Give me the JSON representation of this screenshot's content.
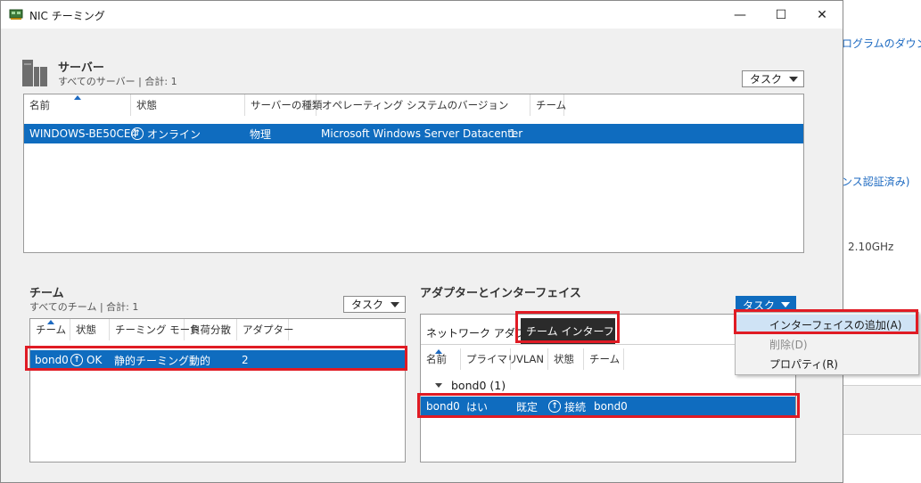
{
  "window": {
    "title": "NIC チーミング",
    "minimize_glyph": "—",
    "maximize_glyph": "☐",
    "close_glyph": "✕"
  },
  "background_app": {
    "line1": "ログラムのダウンロード",
    "line2": "ンス認証済み)",
    "line3": "2.10GHz"
  },
  "servers": {
    "title": "サーバー",
    "subtitle": "すべてのサーバー | 合計: 1",
    "task_label": "タスク",
    "columns": [
      "名前",
      "状態",
      "サーバーの種類",
      "オペレーティング システムのバージョン",
      "チーム"
    ],
    "row": {
      "name": "WINDOWS-BE50CE4",
      "status": "オンライン",
      "server_type": "物理",
      "os_version": "Microsoft Windows Server Datacenter",
      "teams": "1"
    }
  },
  "teams": {
    "title": "チーム",
    "subtitle": "すべてのチーム | 合計: 1",
    "task_label": "タスク",
    "columns": [
      "チーム",
      "状態",
      "チーミング モード",
      "負荷分散",
      "アダプター"
    ],
    "row": {
      "team": "bond0",
      "status": "OK",
      "mode": "静的チーミング",
      "load_balancing": "動的",
      "adapters": "2"
    }
  },
  "adapters": {
    "title": "アダプターとインターフェイス",
    "task_label": "タスク",
    "tabs": [
      "ネットワーク アダプター",
      "チーム インターフェイス"
    ],
    "columns": [
      "名前",
      "プライマリ",
      "VLAN",
      "状態",
      "チーム"
    ],
    "group_label": "bond0 (1)",
    "row": {
      "name": "bond0",
      "primary": "はい",
      "vlan": "既定",
      "status": "接続",
      "team": "bond0"
    }
  },
  "task_menu": {
    "items": [
      {
        "label": "インターフェイスの追加(A)",
        "enabled": true
      },
      {
        "label": "削除(D)",
        "enabled": false
      },
      {
        "label": "プロパティ(R)",
        "enabled": true
      }
    ]
  },
  "colors": {
    "selection": "#0f6cbf",
    "highlight_box": "#e01b24",
    "menu_hover": "#cfe3f5"
  }
}
